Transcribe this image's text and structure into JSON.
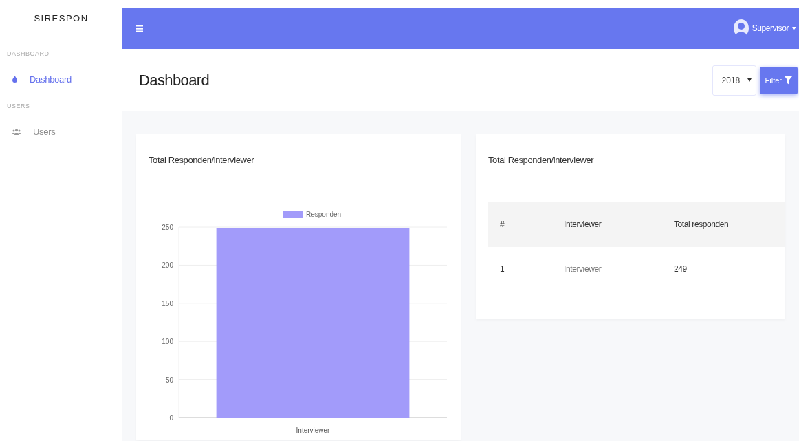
{
  "sidebar": {
    "brand": "SIRESPON",
    "sections": [
      {
        "heading": "DASHBOARD",
        "items": [
          {
            "label": "Dashboard",
            "kind": "drop",
            "selected": true
          }
        ]
      },
      {
        "heading": "USERS",
        "items": [
          {
            "label": "Users",
            "kind": "users",
            "selected": false
          }
        ]
      }
    ]
  },
  "topbar": {
    "user": "Supervisor"
  },
  "header": {
    "title": "Dashboard",
    "year": "2018",
    "filter_button": "Filter"
  },
  "chart_card": {
    "title": "Total Responden/interviewer",
    "chart_data": {
      "type": "bar",
      "categories": [
        "Interviewer"
      ],
      "series": [
        {
          "name": "Responden",
          "color": "#a29bfa",
          "values": [
            249
          ]
        }
      ],
      "ylim": [
        0,
        250
      ],
      "yticks": [
        0,
        50,
        100,
        150,
        200,
        250
      ],
      "grid": true
    }
  },
  "table_card": {
    "title": "Total Responden/interviewer",
    "columns": [
      "#",
      "Interviewer",
      "Total responden"
    ],
    "rows": [
      [
        "1",
        "Interviewer",
        "249"
      ]
    ]
  }
}
